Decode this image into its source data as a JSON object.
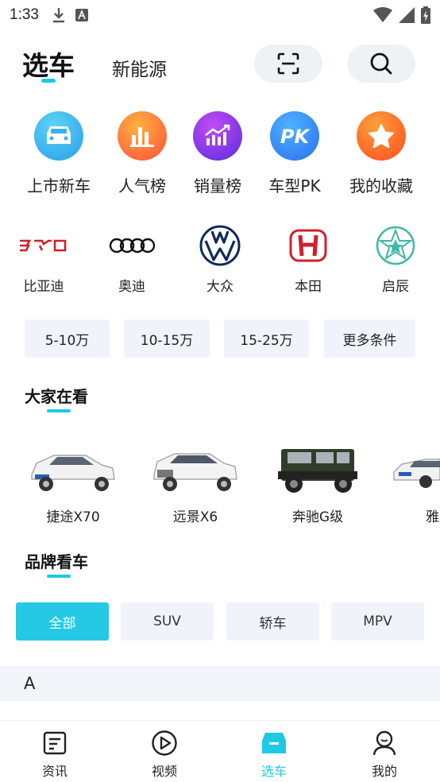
{
  "status_bar": {
    "time": "1:33"
  },
  "tabs": {
    "main": "选车",
    "second": "新能源"
  },
  "quick_entries": [
    {
      "label": "上市新车",
      "icon": "new-car-icon",
      "color": "#2aa8e8"
    },
    {
      "label": "人气榜",
      "icon": "popularity-chart-icon",
      "color": "#ff6a2b"
    },
    {
      "label": "销量榜",
      "icon": "sales-trend-icon",
      "color": "#7b3df0"
    },
    {
      "label": "车型PK",
      "icon": "pk-icon",
      "color": "#2f7df2"
    },
    {
      "label": "我的收藏",
      "icon": "star-icon",
      "color": "#ff5a2a"
    }
  ],
  "brands": [
    {
      "label": "比亚迪",
      "icon": "byd-logo-icon"
    },
    {
      "label": "奥迪",
      "icon": "audi-logo-icon"
    },
    {
      "label": "大众",
      "icon": "volkswagen-logo-icon"
    },
    {
      "label": "本田",
      "icon": "honda-logo-icon"
    },
    {
      "label": "启辰",
      "icon": "venucia-logo-icon"
    }
  ],
  "price_filters": [
    "5-10万",
    "10-15万",
    "15-25万",
    "更多条件"
  ],
  "popular_section": {
    "title": "大家在看"
  },
  "popular_cars": [
    {
      "label": "捷途X70",
      "color": "#f2f2f2"
    },
    {
      "label": "远景X6",
      "color": "#f4f4f4"
    },
    {
      "label": "奔驰G级",
      "color": "#2f3d2a"
    },
    {
      "label": "雅",
      "color": "#f2f2f2"
    }
  ],
  "brand_section": {
    "title": "品牌看车"
  },
  "car_types": [
    "全部",
    "SUV",
    "轿车",
    "MPV"
  ],
  "letter_index": "A",
  "bottom_nav": [
    {
      "label": "资讯",
      "icon": "news-icon"
    },
    {
      "label": "视频",
      "icon": "video-play-icon"
    },
    {
      "label": "选车",
      "icon": "car-select-icon"
    },
    {
      "label": "我的",
      "icon": "profile-icon"
    }
  ],
  "colors": {
    "accent": "#1fc8e3",
    "chip_bg": "#f0f4fa"
  }
}
